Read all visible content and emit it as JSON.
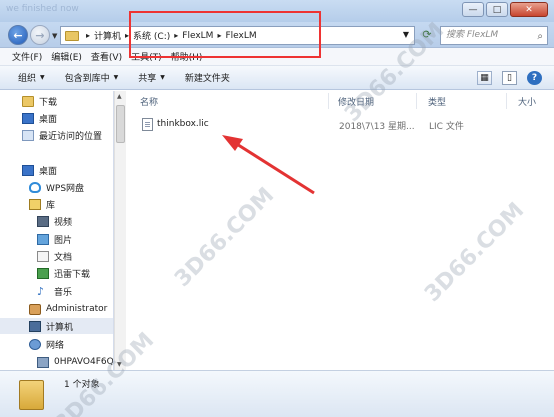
{
  "titlebar": {
    "ghost_text": "we finished now",
    "minimize": "—",
    "maximize": "□",
    "close": "✕"
  },
  "address": {
    "crumbs": [
      "计算机",
      "系统 (C:)",
      "FlexLM",
      "FlexLM"
    ],
    "search_placeholder": "搜索 FlexLM"
  },
  "menu": [
    "文件(F)",
    "编辑(E)",
    "查看(V)",
    "工具(T)",
    "帮助(H)"
  ],
  "toolbar": {
    "organize": "组织",
    "include_library": "包含到库中",
    "share": "共享",
    "new_folder": "新建文件夹"
  },
  "nav": {
    "favorites": [
      "下载",
      "桌面",
      "最近访问的位置"
    ],
    "desktop": "桌面",
    "wps": "WPS网盘",
    "library": "库",
    "library_items": [
      "视频",
      "图片",
      "文档",
      "迅雷下载",
      "音乐"
    ],
    "user": "Administrator",
    "computer": "计算机",
    "network": "网络",
    "host": "0HPAVO4F6Q"
  },
  "columns": {
    "name": "名称",
    "modified": "修改日期",
    "type": "类型",
    "size": "大小"
  },
  "files": [
    {
      "name": "thinkbox.lic",
      "modified": "2018\\7\\13 星期...",
      "type": "LIC 文件"
    }
  ],
  "status": {
    "count": "1 个对象"
  },
  "watermarks": [
    "3D66.COM",
    "3D66.COM",
    "3D66.COM",
    "3D66.COM"
  ],
  "colors": {
    "annotation_red": "#e33333",
    "accent_blue": "#2e6fc0"
  }
}
